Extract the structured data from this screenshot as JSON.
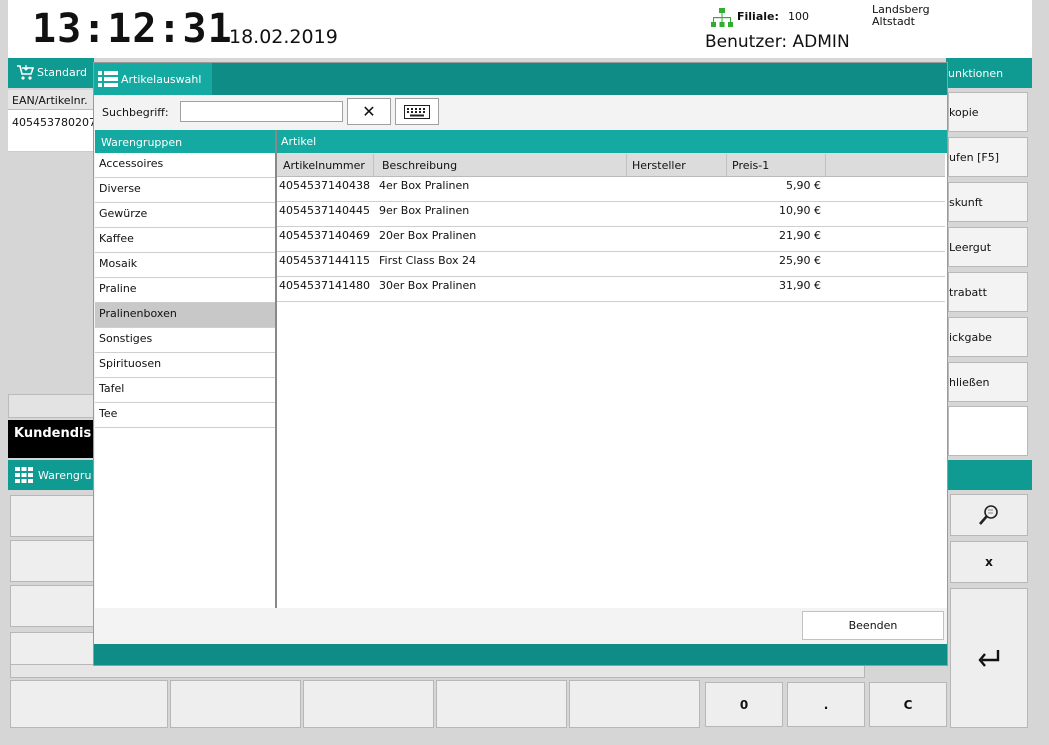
{
  "header": {
    "time": "13:12:31",
    "date": "18.02.2019",
    "filiale_label": "Filiale:",
    "filiale_number": "100",
    "location_line1": "Landsberg",
    "location_line2": "Altstadt",
    "user": "Benutzer: ADMIN"
  },
  "background": {
    "left_bar_label": "Standard",
    "ean_header": "EAN/Artikelnr.",
    "ean_value": "405453780207",
    "customer_display": "Kundendis",
    "warengruppen_bar": "Warengru",
    "functions_bar": "unktionen",
    "right_buttons": [
      "kopie",
      "ufen [F5]",
      "skunft",
      "Leergut",
      "trabatt",
      "ickgabe",
      "hließen"
    ],
    "numpad": {
      "zero": "0",
      "dot": ".",
      "clear": "C",
      "multiply": "x"
    }
  },
  "dialog": {
    "tab_title": "Artikelauswahl",
    "search_label": "Suchbegriff:",
    "search_value": "",
    "clear_symbol": "✕",
    "warengruppen_title": "Warengruppen",
    "warengruppen": [
      "Accessoires",
      "Diverse",
      "Gewürze",
      "Kaffee",
      "Mosaik",
      "Praline",
      "Pralinenboxen",
      "Sonstiges",
      "Spirituosen",
      "Tafel",
      "Tee"
    ],
    "selected_group": "Pralinenboxen",
    "artikel_title": "Artikel",
    "columns": {
      "nummer": "Artikelnummer",
      "beschreibung": "Beschreibung",
      "hersteller": "Hersteller",
      "preis": "Preis-1"
    },
    "rows": [
      {
        "nummer": "4054537140438",
        "beschreibung": "4er Box Pralinen",
        "hersteller": "",
        "preis": "5,90 €"
      },
      {
        "nummer": "4054537140445",
        "beschreibung": "9er Box Pralinen",
        "hersteller": "",
        "preis": "10,90 €"
      },
      {
        "nummer": "4054537140469",
        "beschreibung": "20er Box Pralinen",
        "hersteller": "",
        "preis": "21,90 €"
      },
      {
        "nummer": "4054537144115",
        "beschreibung": "First Class Box 24",
        "hersteller": "",
        "preis": "25,90 €"
      },
      {
        "nummer": "4054537141480",
        "beschreibung": "30er Box Pralinen",
        "hersteller": "",
        "preis": "31,90 €"
      }
    ],
    "close_button": "Beenden"
  },
  "colors": {
    "teal_dark": "#0e8c85",
    "teal_light": "#14a9a1",
    "selected_row": "#c8c8c8"
  },
  "icons": [
    "network-icon",
    "cart-icon",
    "list-icon",
    "grid-icon",
    "keyboard-icon",
    "search-icon",
    "enter-icon",
    "close-icon"
  ]
}
